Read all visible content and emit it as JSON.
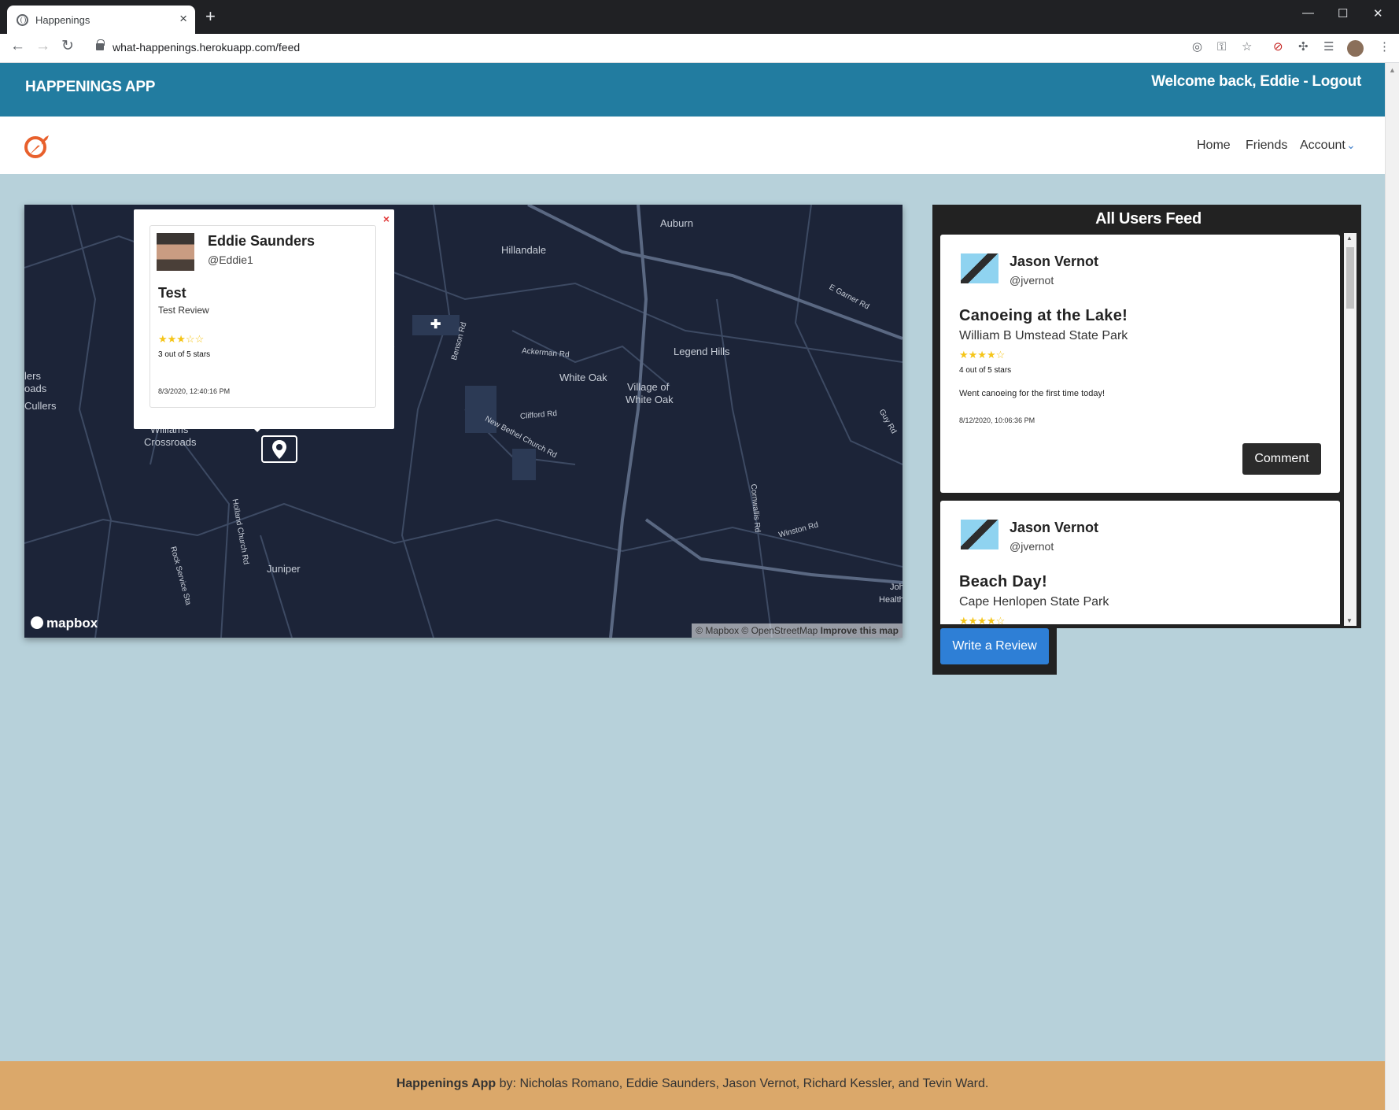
{
  "browser": {
    "tab_title": "Happenings",
    "url": "what-happenings.herokuapp.com/feed"
  },
  "header": {
    "brand": "HAPPENINGS APP",
    "welcome": "Welcome back, Eddie - Logout"
  },
  "nav": {
    "home": "Home",
    "friends": "Friends",
    "account": "Account"
  },
  "map": {
    "labels": [
      "Auburn",
      "Hillandale",
      "Legend Hills",
      "White Oak",
      "Village of",
      "White Oak",
      "Ackerman Rd",
      "Clifford Rd",
      "New Bethel Church Rd",
      "Juniper",
      "Williams",
      "Crossroads",
      "Cullers",
      "lers",
      "oads",
      "E Garner Rd",
      "Benson Rd",
      "Holland Church Rd",
      "Winston Rd",
      "Cornwallis Rd",
      "Rock Service Sta",
      "Guy Rd",
      "Joh",
      "Health"
    ],
    "logo": "mapbox",
    "attribution": "© Mapbox © OpenStreetMap",
    "improve": "Improve this map",
    "popup": {
      "close": "×",
      "name": "Eddie Saunders",
      "handle": "@Eddie1",
      "title": "Test",
      "subtitle": "Test Review",
      "stars": "★★★☆☆",
      "rating_value": 3,
      "rating_text": "3 out of 5 stars",
      "date": "8/3/2020, 12:40:16 PM"
    }
  },
  "feed": {
    "title": "All Users Feed",
    "items": [
      {
        "name": "Jason Vernot",
        "handle": "@jvernot",
        "title": "Canoeing at the Lake!",
        "location": "William B Umstead State Park",
        "stars": "★★★★☆",
        "rating_value": 4,
        "rating_text": "4 out of 5 stars",
        "body": "Went canoeing for the first time today!",
        "date": "8/12/2020, 10:06:36 PM",
        "button": "Comment"
      },
      {
        "name": "Jason Vernot",
        "handle": "@jvernot",
        "title": "Beach Day!",
        "location": "Cape Henlopen State Park",
        "stars": "★★★★☆"
      }
    ],
    "write_button": "Write a Review"
  },
  "footer": {
    "app": "Happenings App",
    "credits": " by: Nicholas Romano, Eddie Saunders, Jason Vernot, Richard Kessler, and Tevin Ward."
  },
  "colors": {
    "appbar": "#227ca0",
    "page_bg": "#b7d1da",
    "footer": "#dba86a",
    "write_button": "#2e7fd6",
    "map_bg": "#1c2438",
    "star": "#f5c518"
  }
}
